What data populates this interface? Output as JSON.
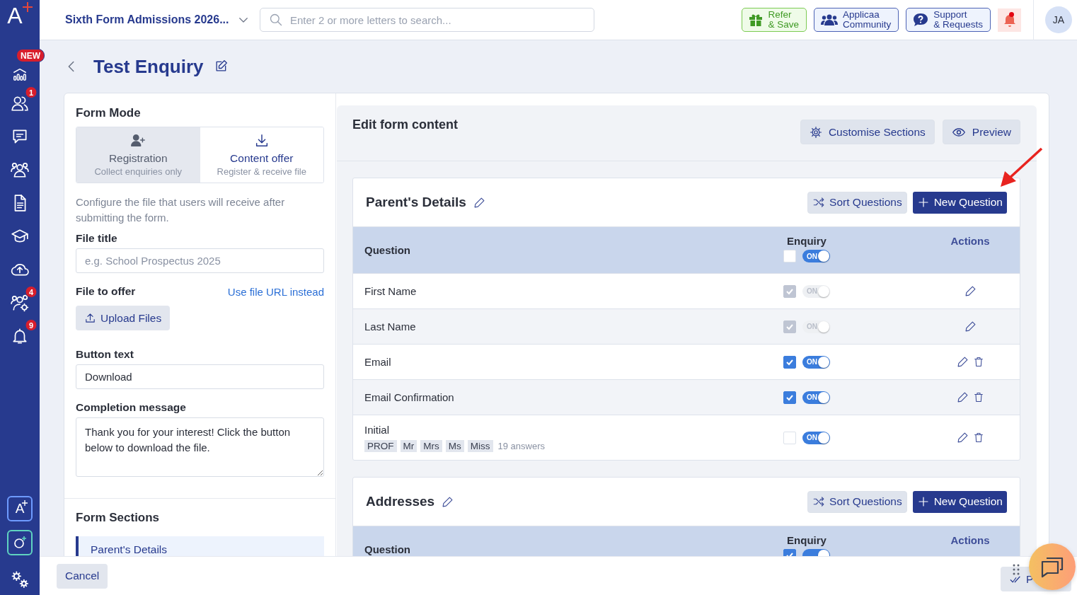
{
  "sidebar": {
    "logo": "A",
    "items": [
      {
        "kind": "chart",
        "badge": "NEW"
      },
      {
        "kind": "people",
        "badge": "1"
      },
      {
        "kind": "message"
      },
      {
        "kind": "group"
      },
      {
        "kind": "document"
      },
      {
        "kind": "graduation"
      },
      {
        "kind": "cloud"
      },
      {
        "kind": "group-gear",
        "badge": "4"
      },
      {
        "kind": "bell",
        "badge": "9"
      }
    ],
    "bottom_items": [
      {
        "kind": "a-plus",
        "text": "A"
      },
      {
        "kind": "o-plus"
      },
      {
        "kind": "gears"
      }
    ]
  },
  "topbar": {
    "admission_select": "Sixth Form Admissions 2026...",
    "search": {
      "placeholder": "Enter 2 or more letters to search..."
    },
    "buttons": [
      {
        "kind": "refer",
        "lines": [
          "Refer",
          "& Save"
        ]
      },
      {
        "kind": "community",
        "lines": [
          "Applicaa",
          "Community"
        ]
      },
      {
        "kind": "support",
        "lines": [
          "Support",
          "& Requests"
        ]
      }
    ],
    "notification_dot": true,
    "avatar": "JA"
  },
  "page": {
    "title": "Test Enquiry"
  },
  "form_mode": {
    "title": "Form Mode",
    "options": [
      {
        "kind": "register",
        "label": "Registration",
        "sub": "Collect enquiries only",
        "selected": false
      },
      {
        "kind": "download",
        "label": "Content offer",
        "sub": "Register & receive file",
        "selected": true
      }
    ],
    "description": "Configure the file that users will receive after submitting the form.",
    "file_title": {
      "label": "File title",
      "placeholder": "e.g. School Prospectus 2025"
    },
    "file_to_offer": {
      "label": "File to offer",
      "link": "Use file URL instead",
      "upload_button": "Upload Files"
    },
    "button_text": {
      "label": "Button text",
      "value": "Download"
    },
    "completion_message": {
      "label": "Completion message",
      "value": "Thank you for your interest! Click the button below to download the file."
    }
  },
  "form_sections": {
    "title": "Form Sections",
    "items": [
      {
        "label": "Parent's Details",
        "selected": true
      }
    ]
  },
  "editor": {
    "title": "Edit form content",
    "buttons": [
      {
        "kind": "gear",
        "label": "Customise Sections"
      },
      {
        "kind": "eye",
        "label": "Preview"
      }
    ],
    "sections": [
      {
        "name": "Parent's Details",
        "sort_button": "Sort Questions",
        "new_button": "New Question",
        "columns": [
          "Question",
          "Enquiry",
          "Actions"
        ],
        "header_checked": false,
        "header_on": true,
        "toggle_text": "ON",
        "rows": [
          {
            "question": "First Name",
            "checked": true,
            "on": true,
            "disabled": true,
            "deletable": false,
            "toggle_text": "ON"
          },
          {
            "question": "Last Name",
            "checked": true,
            "on": true,
            "disabled": true,
            "deletable": false,
            "toggle_text": "ON"
          },
          {
            "question": "Email",
            "checked": true,
            "on": true,
            "disabled": false,
            "deletable": true,
            "toggle_text": "ON"
          },
          {
            "question": "Email Confirmation",
            "checked": true,
            "on": true,
            "disabled": false,
            "deletable": true,
            "toggle_text": "ON"
          },
          {
            "question": "Initial",
            "checked": false,
            "on": true,
            "disabled": false,
            "deletable": true,
            "toggle_text": "ON",
            "options": [
              "PROF",
              "Mr",
              "Mrs",
              "Ms",
              "Miss"
            ],
            "answers": "19 answers"
          }
        ]
      },
      {
        "name": "Addresses",
        "sort_button": "Sort Questions",
        "new_button": "New Question",
        "columns": [
          "Question",
          "Enquiry",
          "Actions"
        ],
        "header_checked": true,
        "header_on": true
      }
    ]
  },
  "annotations": [
    {
      "kind": "arrow"
    }
  ],
  "footer": {
    "buttons": [
      {
        "kind": "cancel",
        "label": "Cancel"
      },
      {
        "kind": "check",
        "label": "P"
      }
    ]
  }
}
